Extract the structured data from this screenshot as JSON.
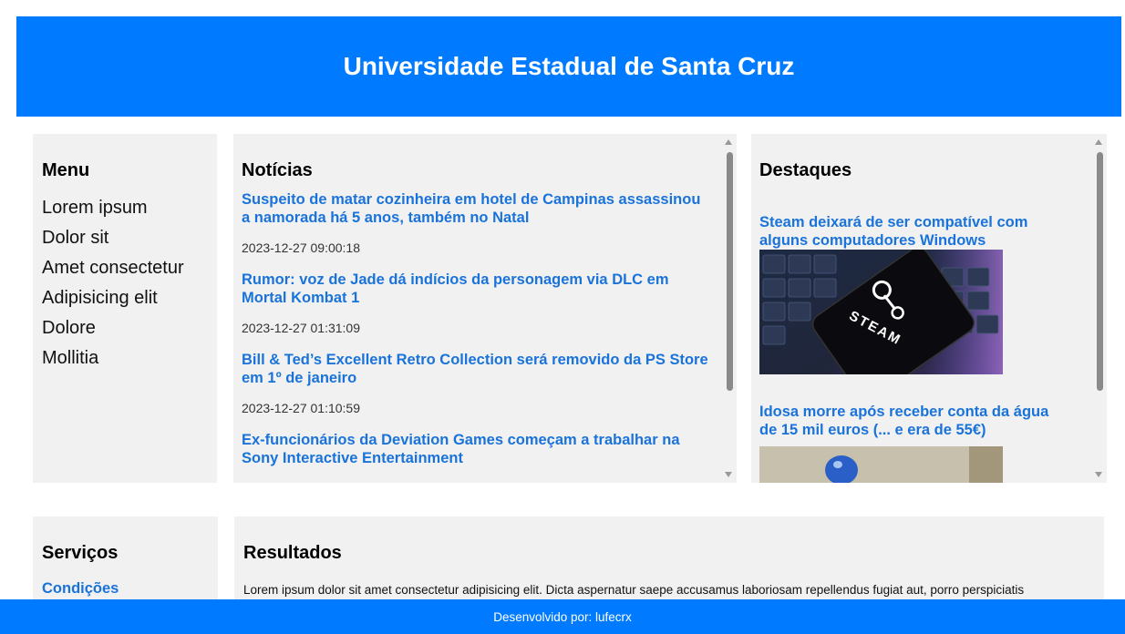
{
  "header": {
    "title": "Universidade Estadual de Santa Cruz"
  },
  "menu": {
    "title": "Menu",
    "items": [
      "Lorem ipsum",
      "Dolor sit",
      "Amet consectetur",
      "Adipisicing elit",
      "Dolore",
      "Mollitia"
    ]
  },
  "news": {
    "title": "Notícias",
    "items": [
      {
        "title": "Suspeito de matar cozinheira em hotel de Campinas assassinou a namorada há 5 anos, também no Natal",
        "date": "2023-12-27 09:00:18"
      },
      {
        "title": "Rumor: voz de Jade dá indícios da personagem via DLC em Mortal Kombat 1",
        "date": "2023-12-27 01:31:09"
      },
      {
        "title": "Bill & Ted’s Excellent Retro Collection será removido da PS Store em 1º de janeiro",
        "date": "2023-12-27 01:10:59"
      },
      {
        "title": "Ex-funcionários da Deviation Games começam a trabalhar na Sony Interactive Entertainment",
        "date": ""
      }
    ]
  },
  "featured": {
    "title": "Destaques",
    "items": [
      {
        "title": "Steam deixará de ser compatível com alguns computadores Windows",
        "image_text": "STEAM"
      },
      {
        "title": "Idosa morre após receber conta da água de 15 mil euros (... e era de 55€)"
      }
    ]
  },
  "services": {
    "title": "Serviços",
    "link": "Condições"
  },
  "results": {
    "title": "Resultados",
    "text": "Lorem ipsum dolor sit amet consectetur adipisicing elit. Dicta aspernatur saepe accusamus laboriosam repellendus fugiat aut, porro perspiciatis"
  },
  "footer": {
    "text": "Desenvolvido por: lufecrx"
  },
  "colors": {
    "accent": "#007bff",
    "link": "#1a73d9",
    "panel": "#f1f1f1"
  }
}
